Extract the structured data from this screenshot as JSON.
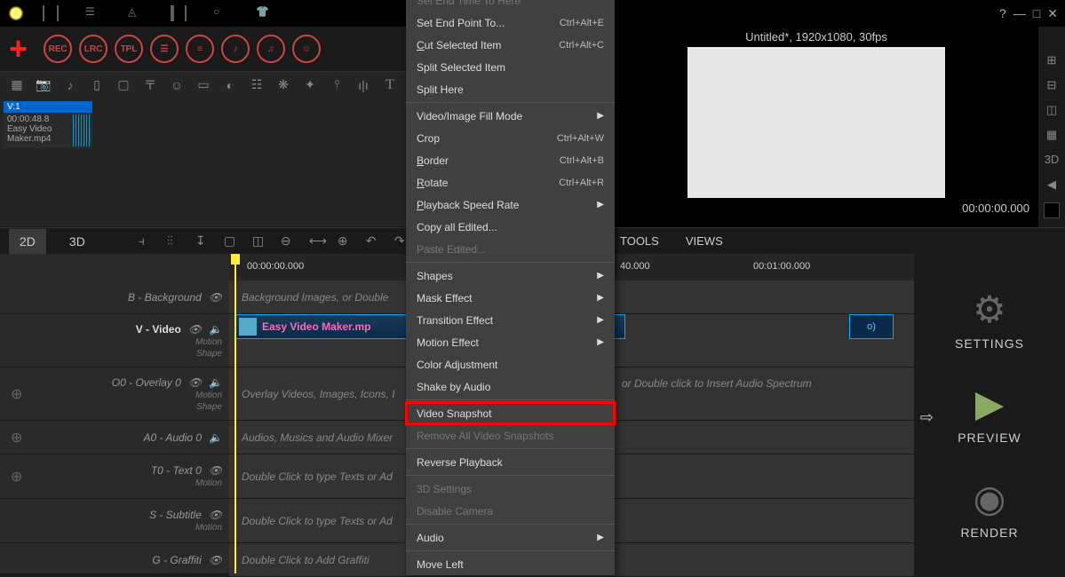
{
  "window": {
    "help": "?",
    "min": "—",
    "max": "□",
    "close": "✕"
  },
  "topToolbar": {
    "rec": "REC",
    "lrc": "LRC",
    "tpl": "TPL"
  },
  "mediaBin": {
    "clip": {
      "head": "V:1",
      "time": "00:00:48.8",
      "name": "Easy Video Maker.mp4"
    }
  },
  "preview": {
    "title": "Untitled*, 1920x1080, 30fps",
    "time": "00:00:00.000"
  },
  "rightStrip": {
    "threeD": "3D"
  },
  "tabs": {
    "d2": "2D",
    "d3": "3D",
    "tools": "TOOLS",
    "views": "VIEWS"
  },
  "ruler": {
    "t0": "00:00:00.000",
    "t1": "40.000",
    "t2": "00:01:00.000"
  },
  "tracks": {
    "bg": {
      "label": "B - Background",
      "hint": "Background Images, or Double"
    },
    "video": {
      "label": "V - Video",
      "motion": "Motion",
      "shape": "Shape",
      "clip": "Easy Video Maker.mp",
      "clipEnd": "o)"
    },
    "overlay": {
      "label": "O0 - Overlay 0",
      "motion": "Motion",
      "shape": "Shape",
      "hint": "Overlay Videos, Images, Icons, I",
      "hint2": "or Double click to Insert Audio Spectrum"
    },
    "audio": {
      "label": "A0 - Audio 0",
      "hint": "Audios, Musics and Audio Mixer"
    },
    "text": {
      "label": "T0 - Text 0",
      "motion": "Motion",
      "hint": "Double Click to type Texts or Ad"
    },
    "subtitle": {
      "label": "S - Subtitle",
      "motion": "Motion",
      "hint": "Double Click to type Texts or Ad"
    },
    "graffiti": {
      "label": "G - Graffiti",
      "hint": "Double Click to Add Graffiti"
    }
  },
  "sideActions": {
    "settings": "SETTINGS",
    "preview": "PREVIEW",
    "render": "RENDER"
  },
  "arrow": "⇨",
  "contextMenu": {
    "setEndTime": "Set End Time To Here",
    "setEndPoint": "Set End Point To...",
    "setEndPointKey": "Ctrl+Alt+E",
    "cut": "Cut Selected Item",
    "cutKey": "Ctrl+Alt+C",
    "split": "Split Selected Item",
    "splitHere": "Split Here",
    "fillMode": "Video/Image Fill Mode",
    "crop": "Crop",
    "cropKey": "Ctrl+Alt+W",
    "border": "Border",
    "borderKey": "Ctrl+Alt+B",
    "rotate": "Rotate",
    "rotateKey": "Ctrl+Alt+R",
    "speed": "Playback Speed Rate",
    "copyAll": "Copy all Edited...",
    "pasteEdited": "Paste Edited...",
    "shapes": "Shapes",
    "mask": "Mask Effect",
    "transition": "Transition Effect",
    "motion": "Motion Effect",
    "colorAdj": "Color Adjustment",
    "shake": "Shake by Audio",
    "snapshot": "Video Snapshot",
    "removeSnap": "Remove All Video Snapshots",
    "reverse": "Reverse Playback",
    "settings3d": "3D Settings",
    "disableCam": "Disable Camera",
    "audio": "Audio",
    "moveLeft": "Move Left"
  }
}
